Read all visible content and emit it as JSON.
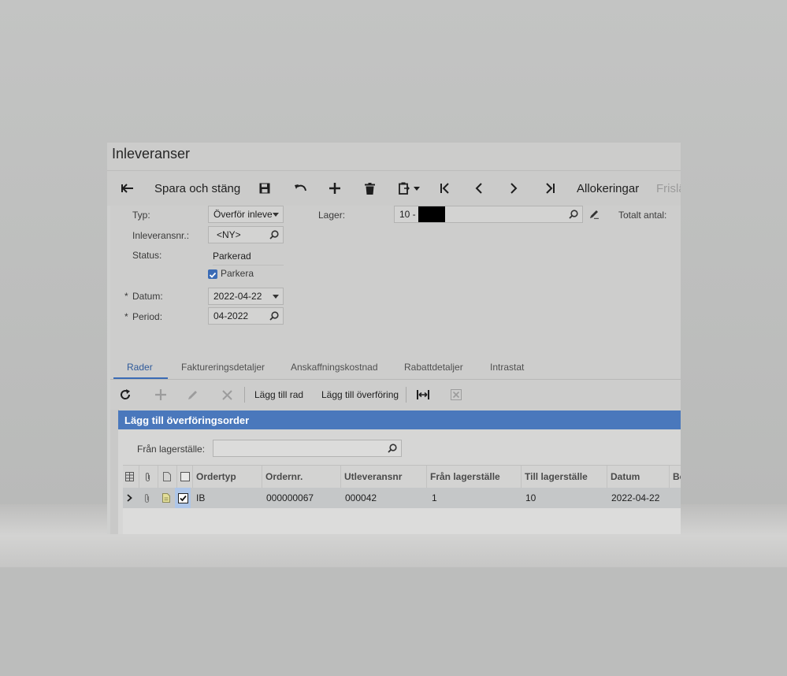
{
  "window": {
    "title": "Inleveranser"
  },
  "toolbar": {
    "save_close": "Spara och stäng",
    "allocations": "Allokeringar",
    "release": "Frislä"
  },
  "form": {
    "type_label": "Typ:",
    "type_value": "Överför inleve",
    "receipt_label": "Inleveransnr.:",
    "receipt_value": "<NY>",
    "status_label": "Status:",
    "status_value": "Parkerad",
    "park_label": "Parkera",
    "park_checked": true,
    "date_label": "Datum:",
    "date_value": "2022-04-22",
    "period_label": "Period:",
    "period_value": "04-2022",
    "warehouse_label": "Lager:",
    "warehouse_value": "10 -",
    "total_label": "Totalt antal:",
    "required_mark": "*"
  },
  "tabs": [
    {
      "label": "Rader",
      "active": true
    },
    {
      "label": "Faktureringsdetaljer"
    },
    {
      "label": "Anskaffningskostnad"
    },
    {
      "label": "Rabattdetaljer"
    },
    {
      "label": "Intrastat"
    }
  ],
  "grid_toolbar": {
    "add_row": "Lägg till rad",
    "add_transfer": "Lägg till överföring"
  },
  "dialog": {
    "title": "Lägg till överföringsorder",
    "from_label": "Från lagerställe:",
    "from_value": "",
    "columns": [
      "Ordertyp",
      "Ordernr.",
      "Utleveransnr",
      "Från lagerställe",
      "Till lagerställe",
      "Datum",
      "Be"
    ],
    "rows": [
      {
        "ordertyp": "IB",
        "ordernr": "000000067",
        "utleveransnr": "000042",
        "fran": "1",
        "till": "10",
        "datum": "2022-04-22",
        "selected": true
      }
    ]
  },
  "colors": {
    "accent": "#4a78bc",
    "tab_active": "#2f5a9a",
    "checkbox": "#3a6bb5"
  }
}
